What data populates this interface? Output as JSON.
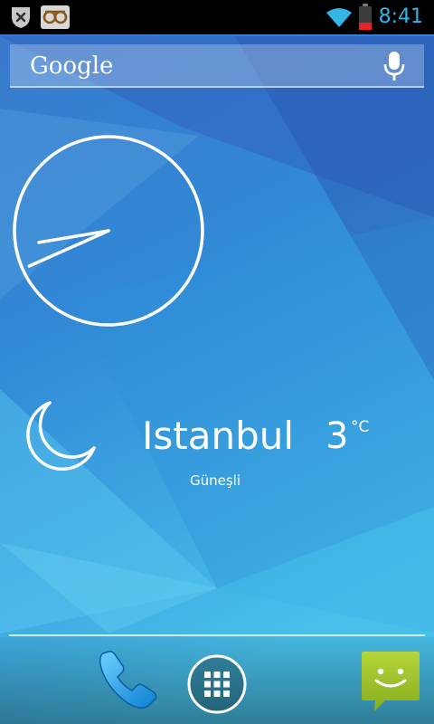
{
  "status_bar": {
    "time": "8:41",
    "notification_icons": [
      "close-notification-icon",
      "mask-app-icon"
    ],
    "system_icons": [
      "wifi-icon",
      "battery-low-icon"
    ]
  },
  "search_bar": {
    "logo_text": "Google",
    "voice_icon": "mic-icon"
  },
  "clock": {
    "type": "analog",
    "hour": 8,
    "minute": 41
  },
  "weather": {
    "city": "Istanbul",
    "temperature": "3",
    "unit": "°C",
    "condition": "Güneşli",
    "icon": "crescent-moon-icon"
  },
  "dock": {
    "apps": [
      "phone-icon",
      "app-drawer-icon",
      "messaging-icon"
    ]
  },
  "colors": {
    "status_accent": "#33b5e5",
    "wallpaper_base": "#2f7fd0",
    "wallpaper_light": "#45bde6",
    "messaging_green": "#9ec42c"
  }
}
